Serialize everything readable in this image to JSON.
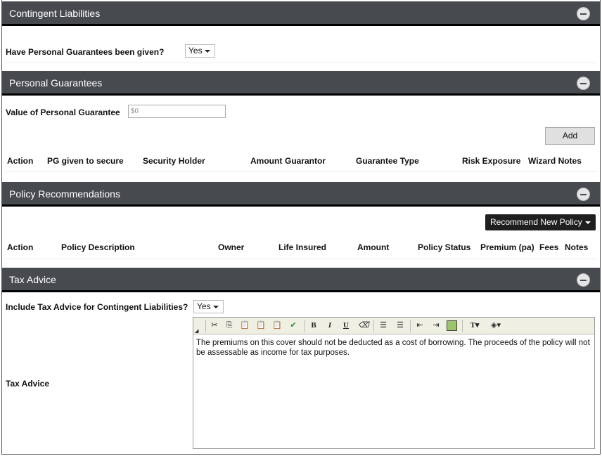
{
  "sections": {
    "contingent": {
      "title": "Contingent Liabilities"
    },
    "personal": {
      "title": "Personal Guarantees"
    },
    "policy": {
      "title": "Policy Recommendations"
    },
    "tax": {
      "title": "Tax Advice"
    }
  },
  "contingent": {
    "question_label": "Have Personal Guarantees been given?",
    "answer": "Yes"
  },
  "personal": {
    "value_label": "Value of Personal Guarantee",
    "value_placeholder": "$0",
    "add_label": "Add",
    "columns": [
      "Action",
      "PG given to secure",
      "Security Holder",
      "Amount",
      "Guarantor",
      "Guarantee Type",
      "Risk Exposure",
      "Wizard Notes"
    ]
  },
  "policy": {
    "recommend_label": "Recommend New Policy",
    "columns": [
      "Action",
      "Policy Description",
      "Owner",
      "Life Insured",
      "Amount",
      "Policy Status",
      "Premium (pa)",
      "Fees",
      "Notes"
    ]
  },
  "tax": {
    "include_label": "Include Tax Advice for Contingent Liabilities?",
    "include_answer": "Yes",
    "advice_label": "Tax Advice",
    "advice_text": "The premiums on this cover should not be deducted as a cost of borrowing. The proceeds of the policy will not be assessable as income for tax purposes.",
    "toolbar": [
      "cut-icon",
      "copy-icon",
      "paste-icon",
      "paste-text-icon",
      "paste-word-icon",
      "spellcheck-icon",
      "bold-icon",
      "italic-icon",
      "underline-icon",
      "clear-format-icon",
      "ordered-list-icon",
      "unordered-list-icon",
      "outdent-icon",
      "indent-icon",
      "image-icon",
      "text-color-icon",
      "background-color-icon"
    ],
    "toolbar_glyphs": {
      "bold": "B",
      "italic": "I",
      "underline": "U"
    }
  }
}
